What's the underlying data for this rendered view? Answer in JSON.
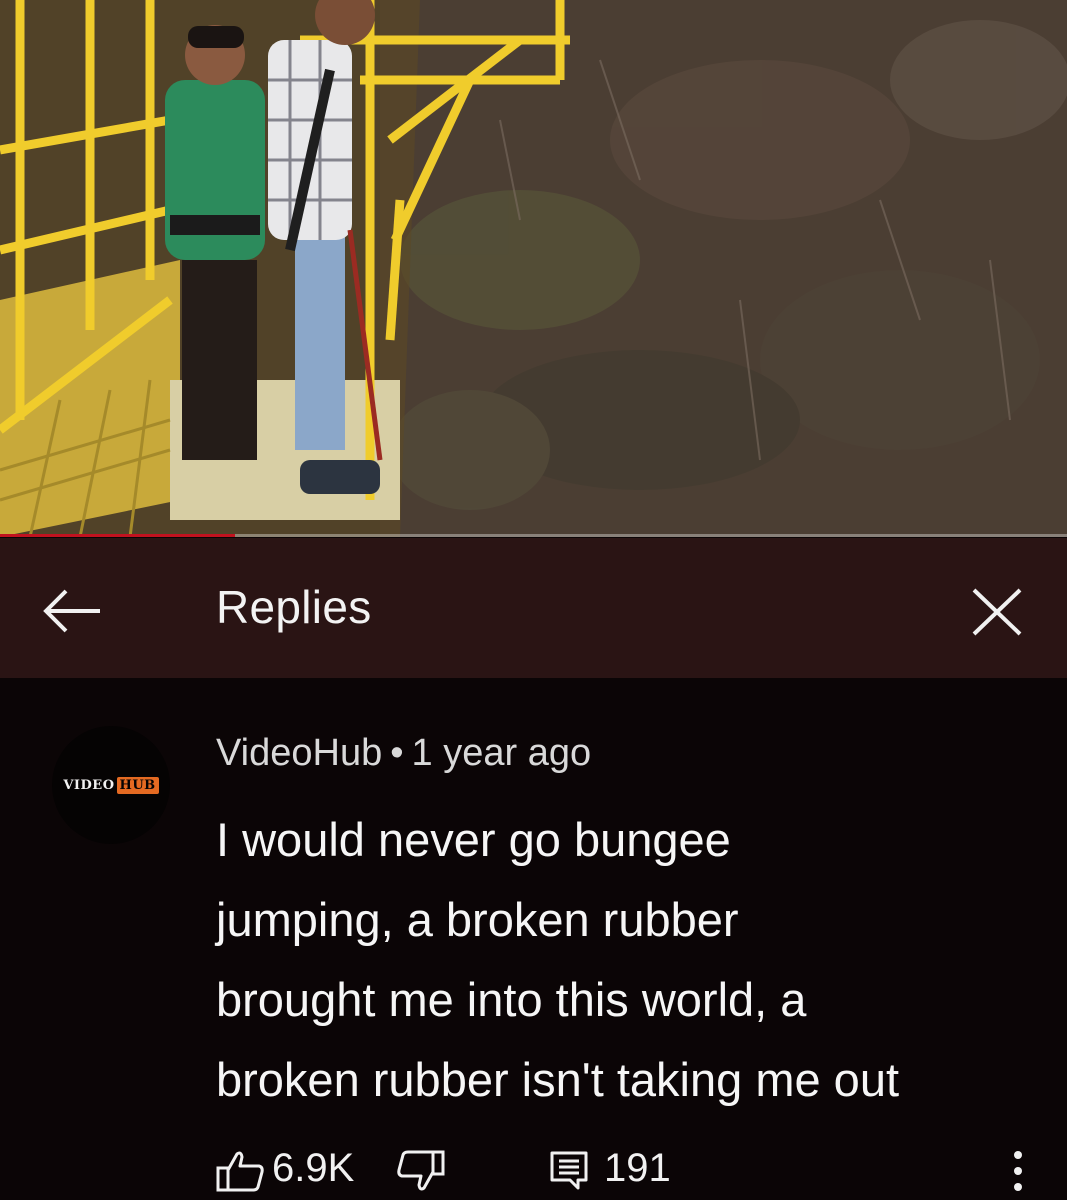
{
  "video": {
    "progress": 0.22,
    "colors": {
      "progress": "#c1121f",
      "track": "#bdbdbd"
    }
  },
  "header": {
    "title": "Replies",
    "back_icon": "arrow-left-icon",
    "close_icon": "close-icon",
    "background": "#2a1414"
  },
  "comment": {
    "avatar": {
      "logo_left": "VIDEO",
      "logo_right": "HUB"
    },
    "author": "VideoHub",
    "separator": "•",
    "time": "1 year ago",
    "lines": [
      "I would never go bungee",
      "jumping, a broken rubber",
      "brought me into this world, a",
      "broken rubber isn't taking me out"
    ],
    "likes": "6.9K",
    "replies": "191",
    "icons": [
      "thumb-up-icon",
      "thumb-down-icon",
      "reply-icon",
      "more-vertical-icon"
    ]
  }
}
